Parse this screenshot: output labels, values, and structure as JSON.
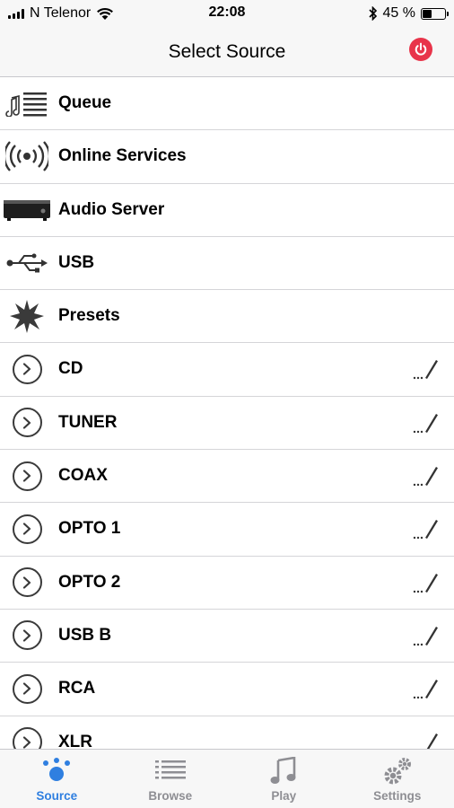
{
  "status_bar": {
    "carrier": "N Telenor",
    "time": "22:08",
    "battery_text": "45 %",
    "battery_level": 0.45
  },
  "nav": {
    "title": "Select Source",
    "power_color": "#e8344a"
  },
  "sources": [
    {
      "label": "Queue",
      "icon": "queue-icon"
    },
    {
      "label": "Online Services",
      "icon": "broadcast-icon"
    },
    {
      "label": "Audio Server",
      "icon": "audio-server-icon"
    },
    {
      "label": "USB",
      "icon": "usb-icon"
    },
    {
      "label": "Presets",
      "icon": "presets-star-icon"
    }
  ],
  "inputs": [
    {
      "label": "CD"
    },
    {
      "label": "TUNER"
    },
    {
      "label": "COAX"
    },
    {
      "label": "OPTO 1"
    },
    {
      "label": "OPTO 2"
    },
    {
      "label": "USB B"
    },
    {
      "label": "RCA"
    },
    {
      "label": "XLR"
    }
  ],
  "tabs": [
    {
      "label": "Source",
      "icon": "source-dots-icon",
      "active": true
    },
    {
      "label": "Browse",
      "icon": "browse-list-icon",
      "active": false
    },
    {
      "label": "Play",
      "icon": "music-note-icon",
      "active": false
    },
    {
      "label": "Settings",
      "icon": "gears-icon",
      "active": false
    }
  ],
  "colors": {
    "accent": "#2f7fe0",
    "inactive_tab": "#8e8e93",
    "power": "#e8344a"
  }
}
